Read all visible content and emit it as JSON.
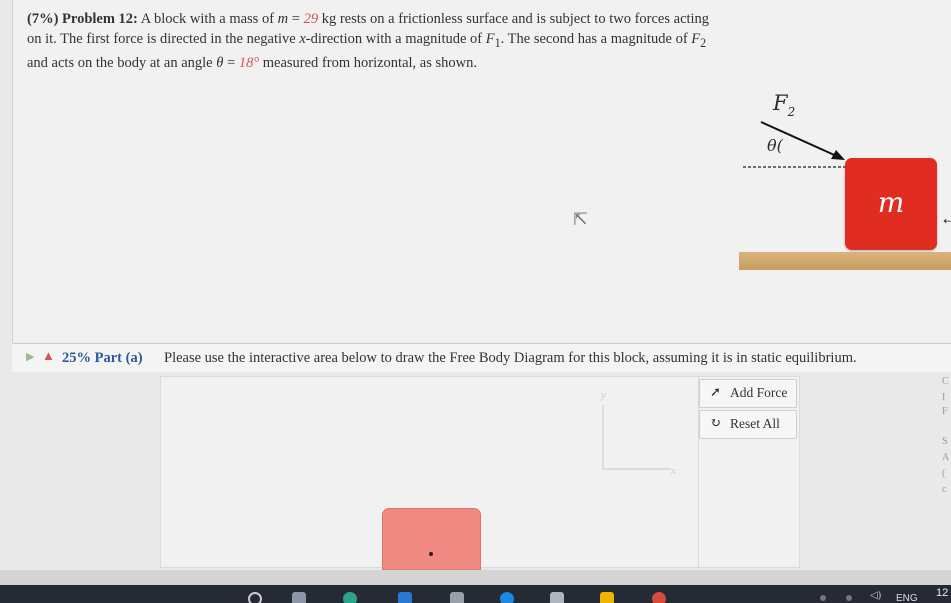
{
  "problem": {
    "weight": "(7%)",
    "title": "Problem 12:",
    "text_1": "A block with a mass of",
    "mass_symbol": "m",
    "equals": "=",
    "mass_value": "29",
    "text_2": "kg rests on a frictionless surface and is subject to two forces acting on it. The first force is directed in the negative",
    "x_symbol": "x",
    "text_3": "-direction with a magnitude of",
    "f1_symbol": "F",
    "f1_sub": "1",
    "text_4": ". The second has a magnitude of",
    "f2_symbol": "F",
    "f2_sub": "2",
    "text_5": "and acts on the body at an angle",
    "theta_symbol": "θ",
    "angle_value": "18°",
    "text_6": "measured from horizontal, as shown."
  },
  "figure": {
    "f2_label": "F",
    "f2_sub": "2",
    "theta_label": "θ(",
    "block_label": "m",
    "f1_arrow": "←",
    "corner_mark": "C"
  },
  "part": {
    "weight": "25%",
    "label": "Part (a)",
    "instruction": "Please use the interactive area below to draw the Free Body Diagram for this block, assuming it is in static equilibrium."
  },
  "canvas": {
    "axis_y": "y",
    "axis_x": "x"
  },
  "tools": {
    "add_force_label": "Add Force",
    "reset_all_label": "Reset All"
  },
  "right_strip": [
    "C",
    "I",
    "F",
    "S",
    "A",
    "(",
    "c"
  ],
  "taskbar": {
    "language": "ENG",
    "clock": "12"
  },
  "colors": {
    "block": "#e12c22",
    "fbd_block": "#f08a83",
    "ground": "#c79d60",
    "accent_blue": "#2b5a9a",
    "red_value": "#d9534f"
  }
}
